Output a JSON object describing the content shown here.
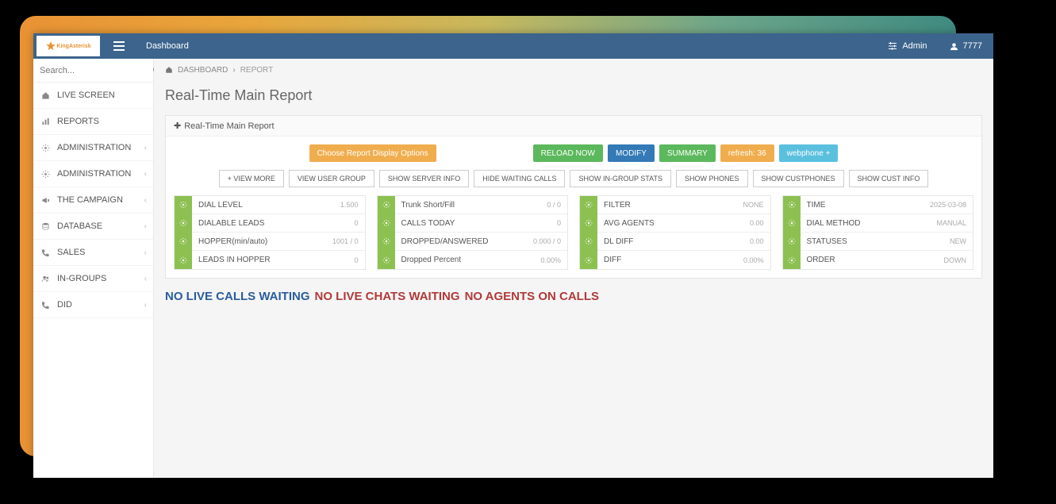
{
  "topbar": {
    "logo_text": "KingAsterisk",
    "dashboard_label": "Dashboard",
    "admin_label": "Admin",
    "user_label": "7777"
  },
  "search": {
    "placeholder": "Search..."
  },
  "sidebar": {
    "items": [
      {
        "icon": "home",
        "label": "LIVE SCREEN",
        "chev": false
      },
      {
        "icon": "chart",
        "label": "REPORTS",
        "chev": false
      },
      {
        "icon": "gear",
        "label": "ADMINISTRATION",
        "chev": true
      },
      {
        "icon": "gear",
        "label": "ADMINISTRATION",
        "chev": true
      },
      {
        "icon": "bullhorn",
        "label": "THE CAMPAIGN",
        "chev": true
      },
      {
        "icon": "db",
        "label": "DATABASE",
        "chev": true
      },
      {
        "icon": "phone",
        "label": "SALES",
        "chev": true
      },
      {
        "icon": "users",
        "label": "IN-GROUPS",
        "chev": true
      },
      {
        "icon": "phone",
        "label": "DID",
        "chev": true
      }
    ]
  },
  "breadcrumb": {
    "root": "DASHBOARD",
    "current": "REPORT"
  },
  "page_title": "Real-Time Main Report",
  "panel_title": "Real-Time Main Report",
  "buttons": {
    "choose": "Choose Report Display Options",
    "reload": "RELOAD NOW",
    "modify": "MODIFY",
    "summary": "SUMMARY",
    "refresh": "refresh: 36",
    "webphone": "webphone +"
  },
  "strip": [
    "+ VIEW MORE",
    "VIEW USER GROUP",
    "SHOW SERVER INFO",
    "HIDE WAITING CALLS",
    "SHOW IN-GROUP STATS",
    "SHOW PHONES",
    "SHOW CUSTPHONES",
    "SHOW CUST INFO"
  ],
  "stats": [
    [
      {
        "label": "DIAL LEVEL",
        "value": "1.500"
      },
      {
        "label": "DIALABLE LEADS",
        "value": "0"
      },
      {
        "label": "HOPPER(min/auto)",
        "value": "1001 / 0"
      },
      {
        "label": "LEADS IN HOPPER",
        "value": "0"
      }
    ],
    [
      {
        "label": "Trunk Short/Fill",
        "value": "0 / 0"
      },
      {
        "label": "CALLS TODAY",
        "value": "0"
      },
      {
        "label": "DROPPED/ANSWERED",
        "value": "0.000 / 0"
      },
      {
        "label": "Dropped Percent",
        "value": "0.00%"
      }
    ],
    [
      {
        "label": "FILTER",
        "value": "NONE"
      },
      {
        "label": "AVG AGENTS",
        "value": "0.00"
      },
      {
        "label": "DL DIFF",
        "value": "0.00"
      },
      {
        "label": "DIFF",
        "value": "0.00%"
      }
    ],
    [
      {
        "label": "TIME",
        "value": "2025-03-08"
      },
      {
        "label": "DIAL METHOD",
        "value": "MANUAL"
      },
      {
        "label": "STATUSES",
        "value": "NEW"
      },
      {
        "label": "ORDER",
        "value": "DOWN"
      }
    ]
  ],
  "status": {
    "calls": "NO LIVE CALLS WAITING",
    "chats": "NO LIVE CHATS WAITING",
    "agents": "NO AGENTS ON CALLS"
  }
}
